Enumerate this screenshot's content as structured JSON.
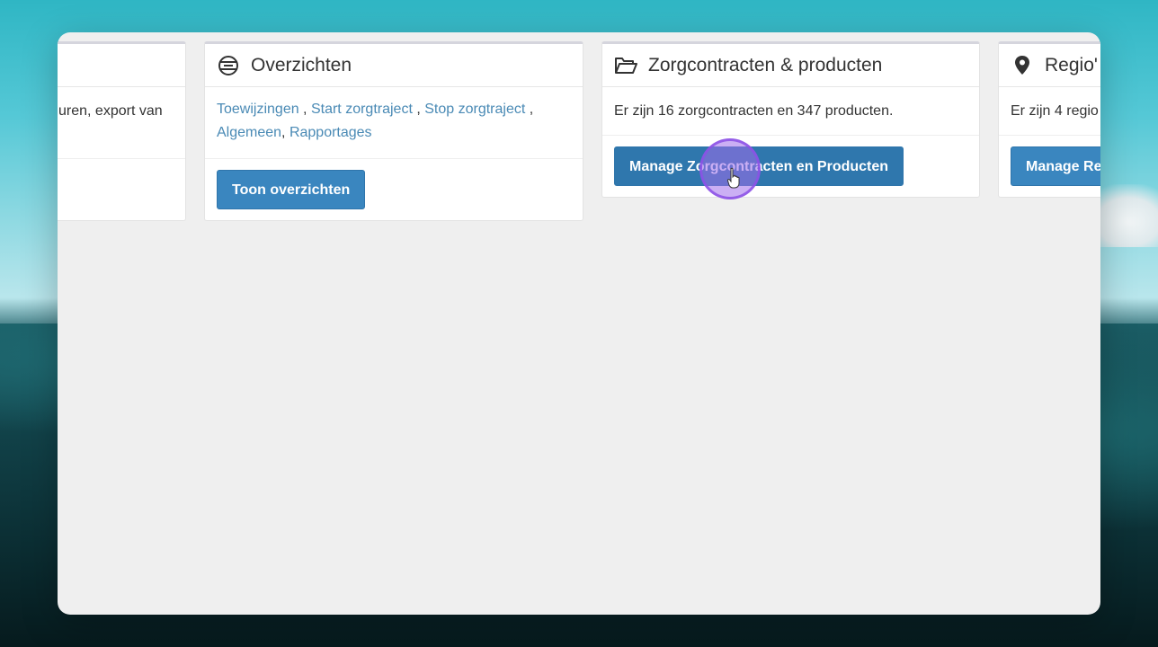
{
  "cards": {
    "partial": {
      "body_text": "uren, export van"
    },
    "overzichten": {
      "title": "Overzichten",
      "links": {
        "toewijzingen": "Toewijzingen",
        "sep1": " , ",
        "start": "Start zorgtraject",
        "sep2": " , ",
        "stop": "Stop zorgtraject",
        "sep3": " ,",
        "algemeen": "Algemeen",
        "sep4": ", ",
        "rapportages": "Rapportages"
      },
      "button": "Toon overzichten"
    },
    "zorgcontracten": {
      "title": "Zorgcontracten & producten",
      "body_text": "Er zijn 16 zorgcontracten en 347 producten.",
      "button": "Manage Zorgcontracten en Producten"
    },
    "regio": {
      "title": "Regio'",
      "body_text": "Er zijn 4 regio",
      "button": "Manage Re"
    }
  },
  "colors": {
    "accent": "#3a86bf",
    "link": "#4a8ab5",
    "cursor_highlight": "#a06eeb"
  },
  "icons": {
    "overzichten": "list-circle-icon",
    "zorgcontracten": "folder-open-icon",
    "regio": "map-marker-icon"
  }
}
